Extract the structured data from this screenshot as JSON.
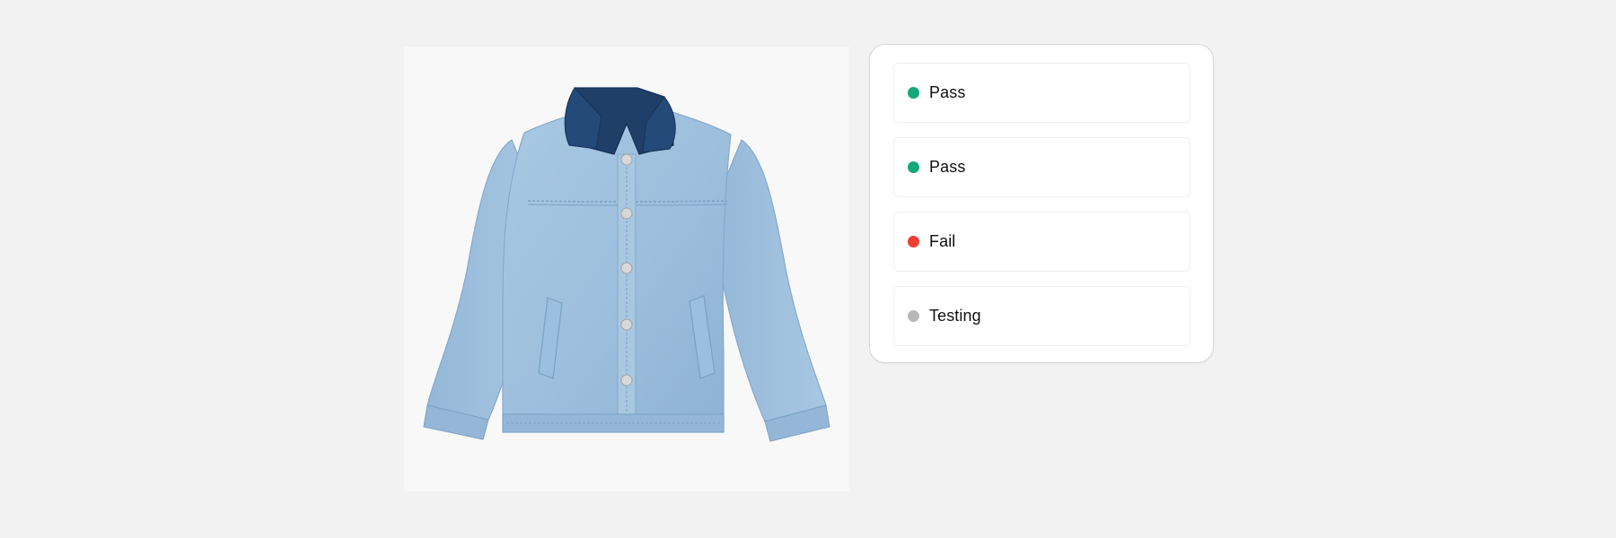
{
  "product": {
    "image_description_name": "denim-jacket-image"
  },
  "statuses": [
    {
      "label": "Pass",
      "color": "#14a876"
    },
    {
      "label": "Pass",
      "color": "#14a876"
    },
    {
      "label": "Fail",
      "color": "#ee3e36"
    },
    {
      "label": "Testing",
      "color": "#b8b8b8"
    }
  ]
}
